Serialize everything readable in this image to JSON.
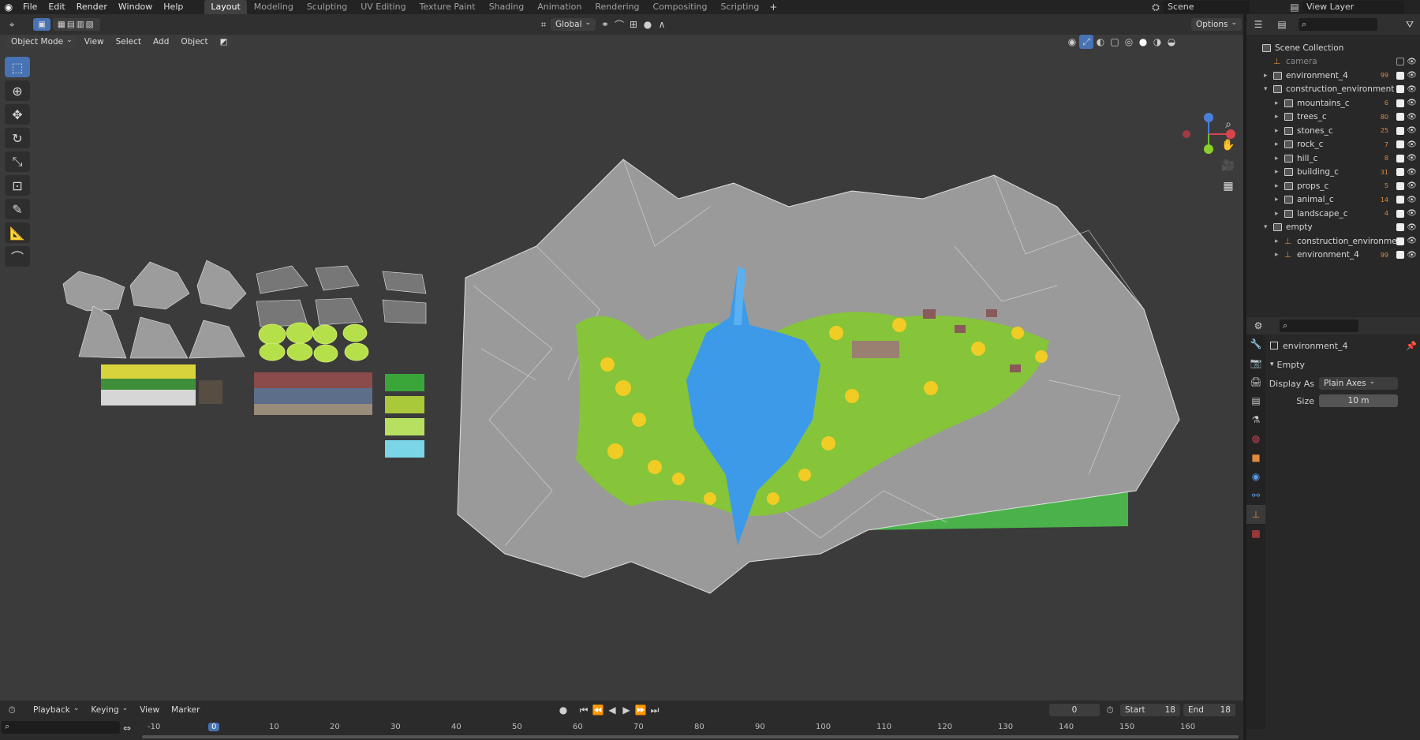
{
  "topbar": {
    "menus": [
      "File",
      "Edit",
      "Render",
      "Window",
      "Help"
    ],
    "workspaces": [
      "Layout",
      "Modeling",
      "Sculpting",
      "UV Editing",
      "Texture Paint",
      "Shading",
      "Animation",
      "Rendering",
      "Compositing",
      "Scripting"
    ],
    "active_workspace": "Layout",
    "scene_label": "Scene",
    "view_layer_label": "View Layer"
  },
  "tool_header": {
    "transform_orientation": "Global",
    "options_label": "Options"
  },
  "viewport_header": {
    "mode": "Object Mode",
    "menus": [
      "View",
      "Select",
      "Add",
      "Object"
    ]
  },
  "outliner": {
    "title": "Scene Collection",
    "items": [
      {
        "name": "camera",
        "indent": 1,
        "expand": "",
        "badge": "",
        "dim": true,
        "collection": false
      },
      {
        "name": "environment_4",
        "indent": 1,
        "expand": "▸",
        "badge": "99",
        "collection": true
      },
      {
        "name": "construction_environment",
        "indent": 1,
        "expand": "▾",
        "badge": "",
        "collection": true
      },
      {
        "name": "mountains_c",
        "indent": 2,
        "expand": "▸",
        "badge": "6",
        "collection": true
      },
      {
        "name": "trees_c",
        "indent": 2,
        "expand": "▸",
        "badge": "80",
        "collection": true
      },
      {
        "name": "stones_c",
        "indent": 2,
        "expand": "▸",
        "badge": "25",
        "collection": true
      },
      {
        "name": "rock_c",
        "indent": 2,
        "expand": "▸",
        "badge": "7",
        "collection": true
      },
      {
        "name": "hill_c",
        "indent": 2,
        "expand": "▸",
        "badge": "8",
        "collection": true
      },
      {
        "name": "building_c",
        "indent": 2,
        "expand": "▸",
        "badge": "31",
        "collection": true
      },
      {
        "name": "props_c",
        "indent": 2,
        "expand": "▸",
        "badge": "5",
        "collection": true
      },
      {
        "name": "animal_c",
        "indent": 2,
        "expand": "▸",
        "badge": "14",
        "collection": true
      },
      {
        "name": "landscape_c",
        "indent": 2,
        "expand": "▸",
        "badge": "4",
        "collection": true
      },
      {
        "name": "empty",
        "indent": 1,
        "expand": "▾",
        "badge": "",
        "collection": true
      },
      {
        "name": "construction_environme",
        "indent": 2,
        "expand": "▸",
        "badge": "",
        "collection": false
      },
      {
        "name": "environment_4",
        "indent": 2,
        "expand": "▸",
        "badge": "99",
        "collection": false
      }
    ]
  },
  "properties": {
    "object_name": "environment_4",
    "panel_title": "Empty",
    "display_as_label": "Display As",
    "display_as_value": "Plain Axes",
    "size_label": "Size",
    "size_value": "10 m"
  },
  "timeline": {
    "menus": [
      "Playback",
      "Keying",
      "View",
      "Marker"
    ],
    "current_frame": "0",
    "start_label": "Start",
    "start_value": "18",
    "end_label": "End",
    "end_value": "18",
    "ruler": [
      "-10",
      "0",
      "10",
      "20",
      "30",
      "40",
      "50",
      "60",
      "70",
      "80",
      "90",
      "100",
      "110",
      "120",
      "130",
      "140",
      "150",
      "160"
    ]
  },
  "colors": {
    "accent": "#4772b3",
    "water": "#3d9ae8",
    "grass": "#6dbb2f",
    "rock": "#9a9a9a"
  }
}
